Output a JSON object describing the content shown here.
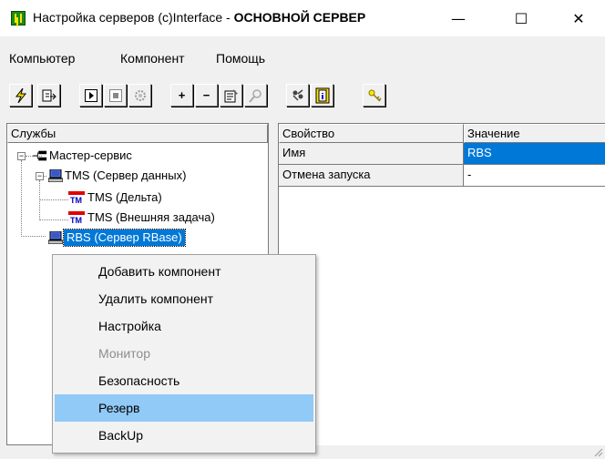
{
  "window": {
    "title_prefix": "Настройка серверов (c)Interface - ",
    "title_bold": "ОСНОВНОЙ СЕРВЕР",
    "minimize": "—",
    "maximize": "☐",
    "close": "✕"
  },
  "menu": [
    "Компьютер",
    "Компонент",
    "Помощь"
  ],
  "toolbar": {
    "buttons": [
      "run-icon",
      "export-icon",
      "start-icon",
      "stop-icon",
      "dim-icon",
      "plus",
      "minus",
      "properties-icon",
      "find-icon",
      "users-icon",
      "info-icon",
      "key-icon"
    ],
    "plus": "+",
    "minus": "−"
  },
  "tree": {
    "header": "Службы",
    "nodes": [
      {
        "label": "Мастер-сервис",
        "icon": "network-icon"
      },
      {
        "label": "TMS (Сервер данных)",
        "icon": "computer-icon"
      },
      {
        "label": "TMS (Дельта)",
        "icon": "tm-icon"
      },
      {
        "label": "TMS (Внешняя задача)",
        "icon": "tm-icon"
      },
      {
        "label": "RBS (Сервер RBase)",
        "icon": "computer-icon",
        "selected": true
      }
    ],
    "expander_minus": "−",
    "tm_label": "TM"
  },
  "grid": {
    "col_property": "Свойство",
    "col_value": "Значение",
    "rows": [
      {
        "property": "Имя",
        "value": "RBS"
      },
      {
        "property": "Отмена запуска",
        "value": "-"
      }
    ]
  },
  "context_menu": {
    "items": [
      {
        "label": "Добавить компонент",
        "state": "normal"
      },
      {
        "label": "Удалить компонент",
        "state": "normal"
      },
      {
        "label": "Настройка",
        "state": "normal"
      },
      {
        "label": "Монитор",
        "state": "disabled"
      },
      {
        "label": "Безопасность",
        "state": "normal"
      },
      {
        "label": "Резерв",
        "state": "highlighted"
      },
      {
        "label": "BackUp",
        "state": "normal"
      }
    ]
  },
  "colors": {
    "selection": "#0078d7",
    "menu_highlight": "#91c9f7",
    "app_icon": "#1a8c1a"
  }
}
